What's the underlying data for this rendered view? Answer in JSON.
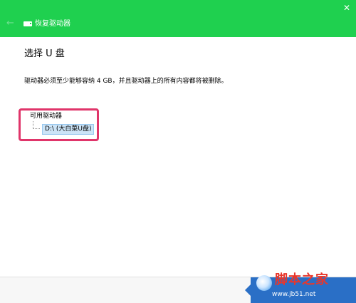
{
  "window": {
    "title": "恢复驱动器",
    "close_glyph": "✕",
    "back_glyph": "←"
  },
  "main": {
    "heading": "选择 U 盘",
    "instruction": "驱动器必须至少能够容纳 4 GB，并且驱动器上的所有内容都将被删除。",
    "list_label": "可用驱动器",
    "drives": [
      {
        "label": "D:\\ (大白菜U盘)",
        "selected": true
      }
    ]
  },
  "watermark": {
    "title": "脚本之家",
    "url": "www.jb51.net"
  },
  "colors": {
    "titlebar": "#1fd04f",
    "highlight_border": "#e0356a",
    "selection": "#cce4f7",
    "footer_accent": "#2a6fc6",
    "watermark_text": "#e8372c"
  },
  "icons": {
    "back": "back-arrow-icon",
    "drive": "drive-icon",
    "close": "close-icon"
  }
}
